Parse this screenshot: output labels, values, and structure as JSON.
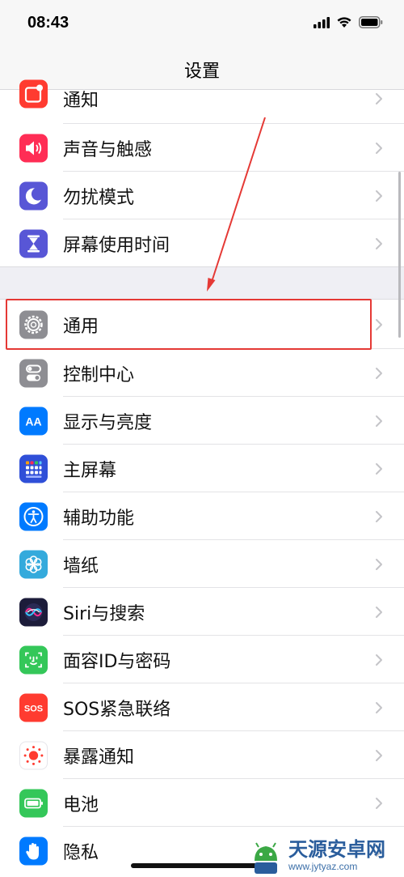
{
  "status_bar": {
    "time": "08:43"
  },
  "nav": {
    "title": "设置"
  },
  "group_a": [
    {
      "label": "通知",
      "icon": "notifications-icon",
      "color": "#ff3b30"
    },
    {
      "label": "声音与触感",
      "icon": "sounds-icon",
      "color": "#ff2d55"
    },
    {
      "label": "勿扰模式",
      "icon": "moon-icon",
      "color": "#5856d6"
    },
    {
      "label": "屏幕使用时间",
      "icon": "hourglass-icon",
      "color": "#5856d6"
    }
  ],
  "group_b": [
    {
      "label": "通用",
      "icon": "gear-icon",
      "color": "#8e8e93"
    },
    {
      "label": "控制中心",
      "icon": "toggles-icon",
      "color": "#8e8e93"
    },
    {
      "label": "显示与亮度",
      "icon": "display-aa-icon",
      "color": "#007aff"
    },
    {
      "label": "主屏幕",
      "icon": "home-grid-icon",
      "color": "#2f4fd8"
    },
    {
      "label": "辅助功能",
      "icon": "accessibility-icon",
      "color": "#007aff"
    },
    {
      "label": "墙纸",
      "icon": "wallpaper-flower-icon",
      "color": "#34aadc"
    },
    {
      "label": "Siri与搜索",
      "icon": "siri-icon",
      "color": "#1c1c3a"
    },
    {
      "label": "面容ID与密码",
      "icon": "face-id-icon",
      "color": "#34c759"
    },
    {
      "label": "SOS紧急联络",
      "icon": "sos-icon",
      "color": "#ff3b30"
    },
    {
      "label": "暴露通知",
      "icon": "exposure-icon",
      "color": "#ffffff"
    },
    {
      "label": "电池",
      "icon": "battery-icon",
      "color": "#34c759"
    },
    {
      "label": "隐私",
      "icon": "hand-icon",
      "color": "#007aff"
    }
  ],
  "watermark": {
    "title": "天源安卓网",
    "url": "www.jytyaz.com"
  },
  "colors": {
    "highlight": "#e53935",
    "arrow": "#e53935"
  }
}
